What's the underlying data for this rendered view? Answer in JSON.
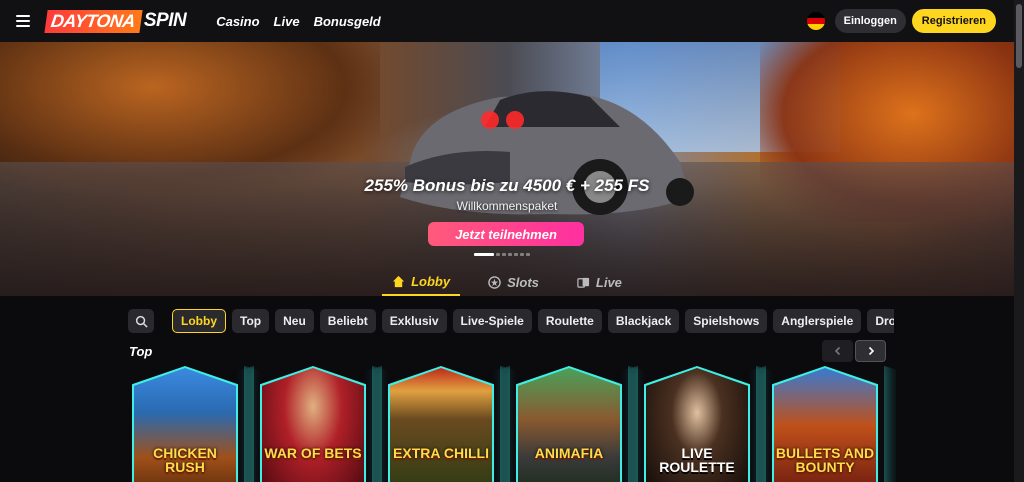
{
  "header": {
    "logo_left": "DAYTONA",
    "logo_right": "SPIN",
    "nav": [
      {
        "label": "Casino"
      },
      {
        "label": "Live"
      },
      {
        "label": "Bonusgeld"
      }
    ],
    "login_label": "Einloggen",
    "register_label": "Registrieren",
    "flag_colors": [
      "#000000",
      "#dd0000",
      "#ffce00"
    ]
  },
  "hero": {
    "title": "255% Bonus bis zu 4500 € + 255 FS",
    "subtitle": "Willkommenspaket",
    "cta_label": "Jetzt teilnehmen",
    "slides_active": 1
  },
  "tabs": [
    {
      "label": "Lobby",
      "icon": "home-icon",
      "active": true
    },
    {
      "label": "Slots",
      "icon": "star-icon",
      "active": false
    },
    {
      "label": "Live",
      "icon": "live-cards-icon",
      "active": false
    }
  ],
  "categories": [
    {
      "label": "Lobby",
      "active": true
    },
    {
      "label": "Top"
    },
    {
      "label": "Neu"
    },
    {
      "label": "Beliebt"
    },
    {
      "label": "Exklusiv"
    },
    {
      "label": "Live-Spiele"
    },
    {
      "label": "Roulette"
    },
    {
      "label": "Blackjack"
    },
    {
      "label": "Spielshows"
    },
    {
      "label": "Anglerspiele"
    },
    {
      "label": "Drops Fre"
    }
  ],
  "section": {
    "title": "Top",
    "prev_icon": "chevron-left-icon",
    "next_icon": "chevron-right-icon"
  },
  "games": [
    {
      "title": "CHICKEN RUSH",
      "bg": [
        "#2a7fd0",
        "#8a3a12"
      ]
    },
    {
      "title": "WAR OF BETS",
      "bg": [
        "#8a0e14",
        "#2a0508"
      ]
    },
    {
      "title": "EXTRA CHILLI",
      "bg": [
        "#5a3a1a",
        "#1a2a10"
      ]
    },
    {
      "title": "ANIMAFIA",
      "bg": [
        "#3a6a3a",
        "#1a2a1a"
      ]
    },
    {
      "title": "LIVE ROULETTE",
      "bg": [
        "#2a1a10",
        "#0a0808"
      ]
    },
    {
      "title": "BULLETS AND BOUNTY",
      "bg": [
        "#2a5aa0",
        "#4a1a10"
      ]
    }
  ],
  "colors": {
    "accent": "#ffd61f",
    "cta": "#ff3e94",
    "card_border": "#3df0e6"
  }
}
